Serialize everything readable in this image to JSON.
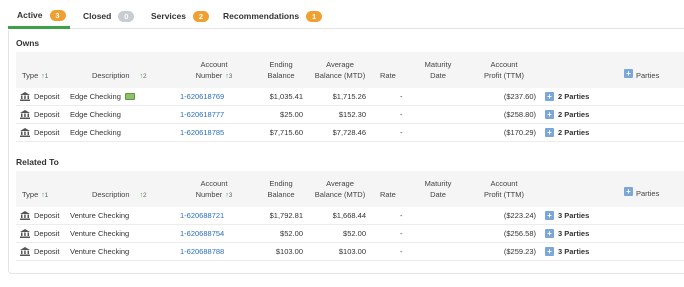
{
  "tabs": [
    {
      "label": "Active",
      "count": "3",
      "color": "orange"
    },
    {
      "label": "Closed",
      "count": "0",
      "color": "gray"
    },
    {
      "label": "Services",
      "count": "2",
      "color": "orange"
    },
    {
      "label": "Recommendations",
      "count": "1",
      "color": "orange"
    }
  ],
  "headers": {
    "type": "Type",
    "description": "Description",
    "account_number_1": "Account",
    "account_number_2": "Number",
    "ending_balance_1": "Ending",
    "ending_balance_2": "Balance",
    "average_balance_1": "Average",
    "average_balance_2": "Balance (MTD)",
    "rate": "Rate",
    "maturity_1": "Maturity",
    "maturity_2": "Date",
    "profit_1": "Account",
    "profit_2": "Profit (TTM)",
    "parties": "Parties",
    "sort_1": "1",
    "sort_2": "2",
    "sort_3": "3"
  },
  "owns": {
    "title": "Owns",
    "rows": [
      {
        "type": "Deposit",
        "description": "Edge Checking",
        "account": "1-620618769",
        "ending": "$1,035.41",
        "average": "$1,715.26",
        "rate": "-",
        "maturity": "",
        "profit": "($237.60)",
        "parties": "2 Parties"
      },
      {
        "type": "Deposit",
        "description": "Edge Checking",
        "account": "1-620618777",
        "ending": "$25.00",
        "average": "$152.30",
        "rate": "-",
        "maturity": "",
        "profit": "($258.80)",
        "parties": "2 Parties"
      },
      {
        "type": "Deposit",
        "description": "Edge Checking",
        "account": "1-620618785",
        "ending": "$7,715.60",
        "average": "$7,728.46",
        "rate": "-",
        "maturity": "",
        "profit": "($170.29)",
        "parties": "2 Parties"
      }
    ]
  },
  "related": {
    "title": "Related To",
    "rows": [
      {
        "type": "Deposit",
        "description": "Venture Checking",
        "account": "1-620688721",
        "ending": "$1,792.81",
        "average": "$1,668.44",
        "rate": "-",
        "maturity": "",
        "profit": "($223.24)",
        "parties": "3 Parties"
      },
      {
        "type": "Deposit",
        "description": "Venture Checking",
        "account": "1-620688754",
        "ending": "$52.00",
        "average": "$52.00",
        "rate": "-",
        "maturity": "",
        "profit": "($256.58)",
        "parties": "3 Parties"
      },
      {
        "type": "Deposit",
        "description": "Venture Checking",
        "account": "1-620688788",
        "ending": "$103.00",
        "average": "$103.00",
        "rate": "-",
        "maturity": "",
        "profit": "($259.23)",
        "parties": "3 Parties"
      }
    ]
  },
  "colors": {
    "accent": "#3da146",
    "badge_orange": "#f0a030",
    "badge_gray": "#c8cdd3",
    "link": "#2a6ebb",
    "plus": "#7aa7d8"
  }
}
